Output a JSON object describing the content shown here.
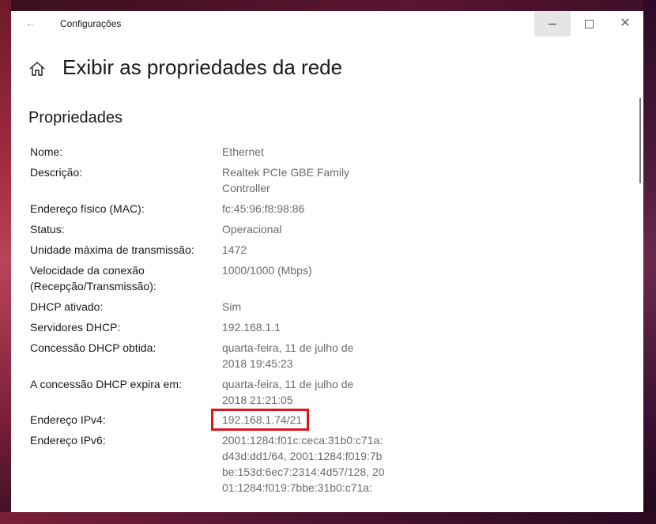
{
  "window": {
    "app_title": "Configurações",
    "back_icon": "back-arrow-icon",
    "controls": {
      "minimize": "minimize-icon",
      "maximize": "maximize-icon",
      "close": "close-icon"
    }
  },
  "page": {
    "title": "Exibir as propriedades da rede",
    "home_icon": "home-icon"
  },
  "section": {
    "title": "Propriedades"
  },
  "properties": [
    {
      "label": "Nome:",
      "value": "Ethernet"
    },
    {
      "label": "Descrição:",
      "value": "Realtek PCIe GBE Family Controller"
    },
    {
      "label": "Endereço físico (MAC):",
      "value": "fc:45:96:f8:98:86"
    },
    {
      "label": "Status:",
      "value": "Operacional"
    },
    {
      "label": "Unidade máxima de transmissão:",
      "value": "1472"
    },
    {
      "label": "Velocidade da conexão (Recepção/Transmissão):",
      "value": "1000/1000 (Mbps)"
    },
    {
      "label": "DHCP ativado:",
      "value": "Sim"
    },
    {
      "label": "Servidores DHCP:",
      "value": "192.168.1.1"
    },
    {
      "label": "Concessão DHCP obtida:",
      "value": "quarta-feira, 11 de julho de 2018 19:45:23"
    },
    {
      "label": "A concessão DHCP expira em:",
      "value": "quarta-feira, 11 de julho de 2018 21:21:05"
    },
    {
      "label": "Endereço IPv4:",
      "value": "192.168.1.74/21"
    },
    {
      "label": "Endereço IPv6:",
      "value": "2001:1284:f01c:ceca:31b0:c71a:d43d:dd1/64, 2001:1284:f019:7bbe:153d:6ec7:2314:4d57/128, 2001:1284:f019:7bbe:31b0:c71a:"
    }
  ],
  "colors": {
    "highlight": "#e0141e",
    "value_text": "#6b6b6b"
  }
}
